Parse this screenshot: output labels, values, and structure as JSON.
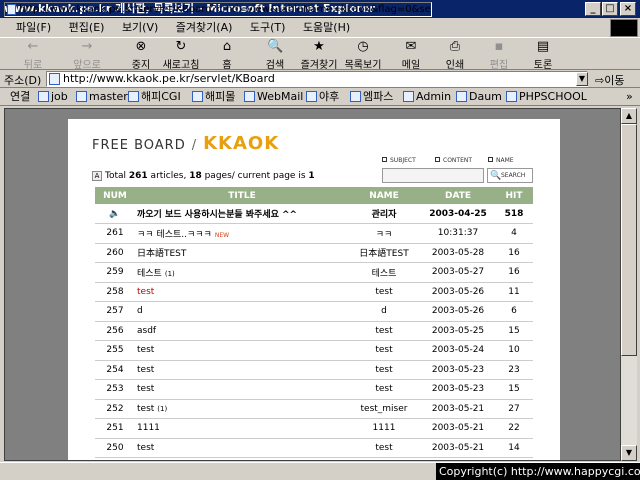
{
  "window": {
    "title": "www.kkaok.pe.kr 게시판, 목록보기 - Microsoft Internet Explorer",
    "min": "_",
    "max": "□",
    "close": "×"
  },
  "menu": [
    "파일(F)",
    "편집(E)",
    "보기(V)",
    "즐겨찾기(A)",
    "도구(T)",
    "도움말(H)"
  ],
  "toolbar": {
    "back": {
      "label": "뒤로",
      "icon": "←"
    },
    "forward": {
      "label": "앞으로",
      "icon": "→"
    },
    "stop": {
      "label": "중지",
      "icon": "⊗"
    },
    "refresh": {
      "label": "새로고침",
      "icon": "↻"
    },
    "home": {
      "label": "홈",
      "icon": "⌂"
    },
    "search": {
      "label": "검색",
      "icon": "🔍"
    },
    "favorites": {
      "label": "즐겨찾기",
      "icon": "★"
    },
    "history": {
      "label": "목록보기",
      "icon": "◷"
    },
    "mail": {
      "label": "메일",
      "icon": "✉"
    },
    "print": {
      "label": "인쇄",
      "icon": "⎙"
    },
    "edit": {
      "label": "편집",
      "icon": "▪"
    },
    "discuss": {
      "label": "토론",
      "icon": "▤"
    }
  },
  "address": {
    "label": "주소(D)",
    "url": "http://www.kkaok.pe.kr/servlet/KBoard",
    "go": "이동"
  },
  "links": {
    "label": "연결",
    "items": [
      "job",
      "master",
      "해피CGI",
      "해피몰",
      "WebMail",
      "야후",
      "엠파스",
      "Admin",
      "Daum",
      "PHPSCHOOL"
    ],
    "more": "»"
  },
  "board": {
    "brand": "FREE BOARD",
    "slash": "/",
    "brand_accent": "KKAOK",
    "search_options": [
      "SUBJECT",
      "CONTENT",
      "NAME"
    ],
    "search_button": "SEARCH",
    "summary": {
      "pre": "Total ",
      "total": "261",
      "mid": " articles, ",
      "pages": "18",
      "mid2": " pages/ current page is ",
      "current": "1"
    },
    "columns": {
      "num": "NUM",
      "title": "TITLE",
      "name": "NAME",
      "date": "DATE",
      "hit": "HIT"
    },
    "notice": {
      "title": "까오기 보드 사용하시는분들 봐주세요 ^^",
      "name": "관리자",
      "date": "2003-04-25",
      "hit": "518"
    },
    "rows": [
      {
        "num": "261",
        "title": "ㅋㅋ 테스트..ㅋㅋㅋ",
        "badge": "NEW",
        "comments": "",
        "name": "ㅋㅋ",
        "date": "10:31:37",
        "hit": "4",
        "color": "#000"
      },
      {
        "num": "260",
        "title": "日本語TEST",
        "badge": "",
        "comments": "",
        "name": "日本語TEST",
        "date": "2003-05-28",
        "hit": "16",
        "color": "#000"
      },
      {
        "num": "259",
        "title": "테스트",
        "badge": "",
        "comments": "(1)",
        "name": "테스트",
        "date": "2003-05-27",
        "hit": "16",
        "color": "#000"
      },
      {
        "num": "258",
        "title": "test",
        "badge": "",
        "comments": "",
        "name": "test",
        "date": "2003-05-26",
        "hit": "11",
        "color": "#c00000"
      },
      {
        "num": "257",
        "title": "d",
        "badge": "",
        "comments": "",
        "name": "d",
        "date": "2003-05-26",
        "hit": "6",
        "color": "#000"
      },
      {
        "num": "256",
        "title": "asdf",
        "badge": "",
        "comments": "",
        "name": "test",
        "date": "2003-05-25",
        "hit": "15",
        "color": "#000"
      },
      {
        "num": "255",
        "title": "test",
        "badge": "",
        "comments": "",
        "name": "test",
        "date": "2003-05-24",
        "hit": "10",
        "color": "#000"
      },
      {
        "num": "254",
        "title": "test",
        "badge": "",
        "comments": "",
        "name": "test",
        "date": "2003-05-23",
        "hit": "23",
        "color": "#000"
      },
      {
        "num": "253",
        "title": "test",
        "badge": "",
        "comments": "",
        "name": "test",
        "date": "2003-05-23",
        "hit": "15",
        "color": "#000"
      },
      {
        "num": "252",
        "title": "test",
        "badge": "",
        "comments": "(1)",
        "name": "test_miser",
        "date": "2003-05-21",
        "hit": "27",
        "color": "#000"
      },
      {
        "num": "251",
        "title": "1111",
        "badge": "",
        "comments": "",
        "name": "1111",
        "date": "2003-05-21",
        "hit": "22",
        "color": "#000"
      },
      {
        "num": "250",
        "title": "test",
        "badge": "",
        "comments": "",
        "name": "test",
        "date": "2003-05-21",
        "hit": "14",
        "color": "#000"
      }
    ]
  },
  "status": {
    "text": "http://www.kkaok.pe.kr/servlet/KBoard?cmd=view&tableName=kkaok&flag=0&search=&findword=",
    "copyright": "Copyright(c) http://www.happycgi.com"
  },
  "colors": {
    "header_bg": "#98b088",
    "accent": "#e8a010",
    "titlebar": "#0a246a"
  }
}
